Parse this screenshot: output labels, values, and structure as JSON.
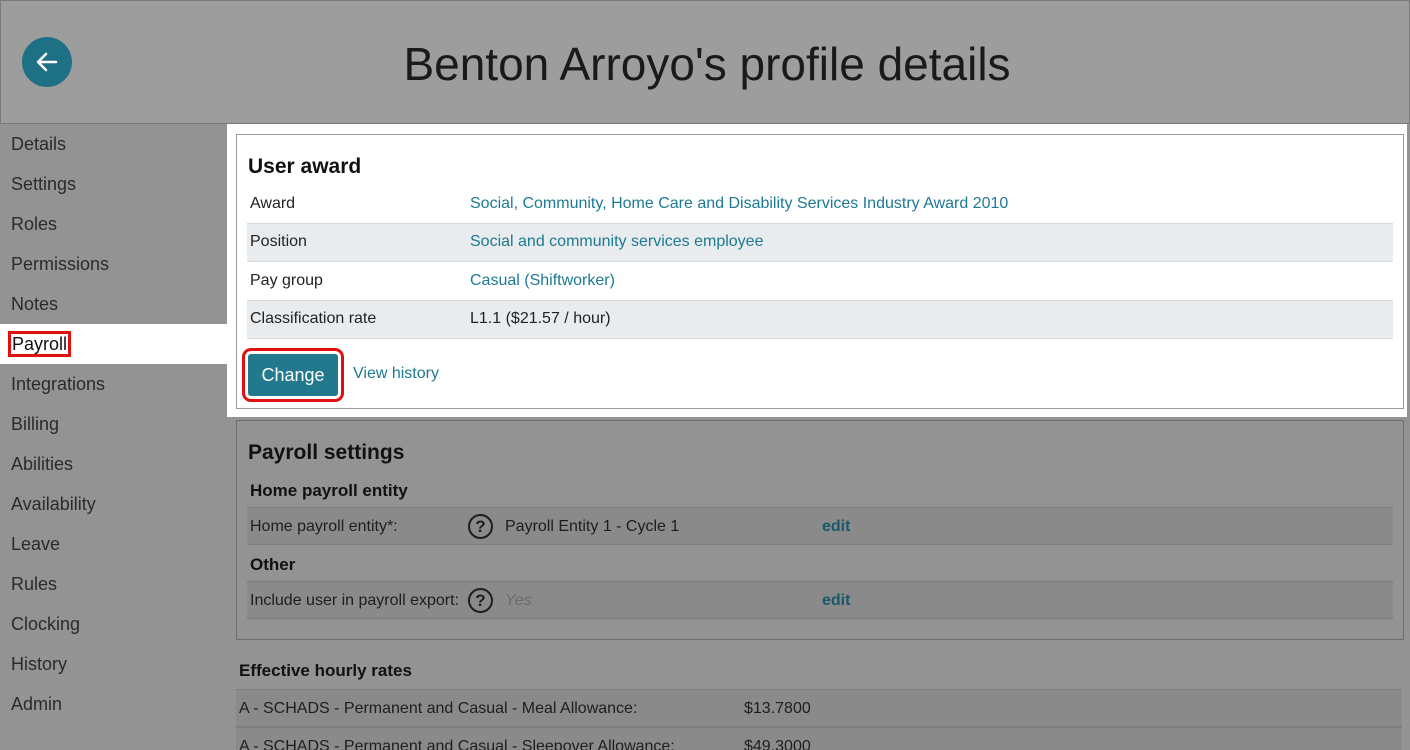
{
  "header": {
    "title": "Benton Arroyo's profile details",
    "back_icon": "arrow-left-icon"
  },
  "sidebar": {
    "items": [
      {
        "label": "Details"
      },
      {
        "label": "Settings"
      },
      {
        "label": "Roles"
      },
      {
        "label": "Permissions"
      },
      {
        "label": "Notes"
      },
      {
        "label": "Payroll",
        "active": true
      },
      {
        "label": "Integrations"
      },
      {
        "label": "Billing"
      },
      {
        "label": "Abilities"
      },
      {
        "label": "Availability"
      },
      {
        "label": "Leave"
      },
      {
        "label": "Rules"
      },
      {
        "label": "Clocking"
      },
      {
        "label": "History"
      },
      {
        "label": "Admin"
      }
    ]
  },
  "user_award": {
    "title": "User award",
    "rows": [
      {
        "key": "Award",
        "value": "Social, Community, Home Care and Disability Services Industry Award 2010"
      },
      {
        "key": "Position",
        "value": "Social and community services employee"
      },
      {
        "key": "Pay group",
        "value": "Casual (Shiftworker)"
      },
      {
        "key": "Classification rate",
        "value": "L1.1 ($21.57 / hour)"
      }
    ],
    "change_label": "Change",
    "view_history_label": "View history"
  },
  "payroll_settings": {
    "title": "Payroll settings",
    "home_heading": "Home payroll entity",
    "home_row": {
      "key": "Home payroll entity*:",
      "value": "Payroll Entity 1 - Cycle 1",
      "edit": "edit"
    },
    "other_heading": "Other",
    "other_row": {
      "key": "Include user in payroll export:",
      "value": "Yes",
      "edit": "edit"
    },
    "help_glyph": "?"
  },
  "effective_rates": {
    "title": "Effective hourly rates",
    "rows": [
      {
        "key": "A - SCHADS - Permanent and Casual - Meal Allowance:",
        "value": "$13.7800"
      },
      {
        "key": "A - SCHADS - Permanent and Casual - Sleepover Allowance:",
        "value": "$49.3000"
      }
    ]
  },
  "colors": {
    "accent": "#22798e",
    "link": "#1d7a93",
    "highlight": "#e01010"
  }
}
